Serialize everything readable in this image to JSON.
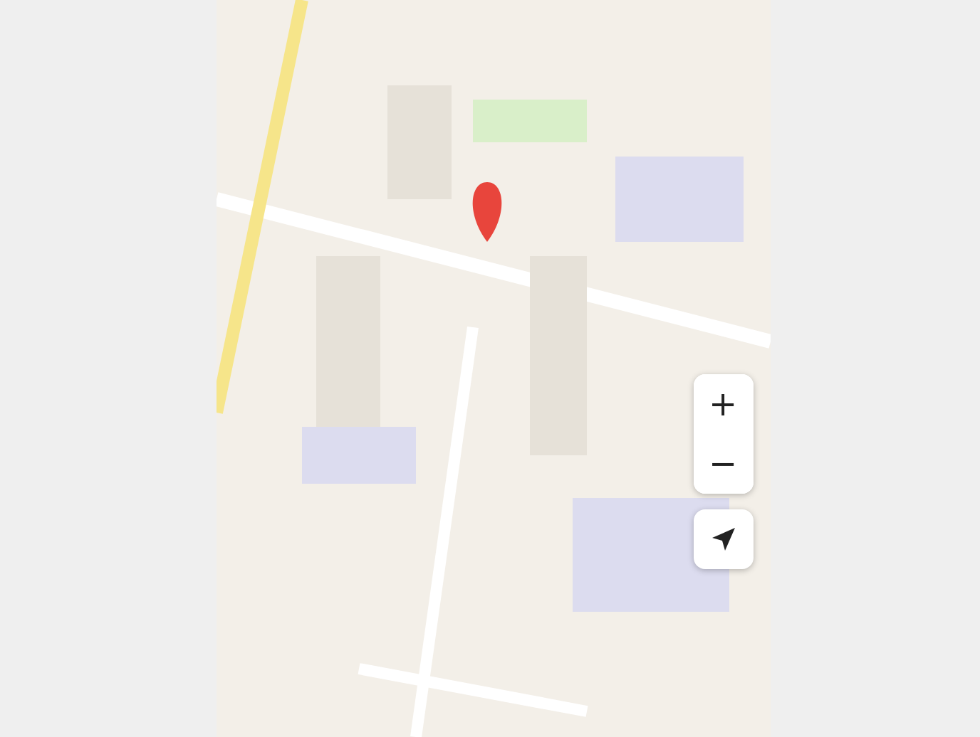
{
  "map_controls": [
    {
      "kind": "zoom_in",
      "label": "+"
    },
    {
      "kind": "zoom_out",
      "label": "−"
    },
    {
      "kind": "locate"
    }
  ]
}
